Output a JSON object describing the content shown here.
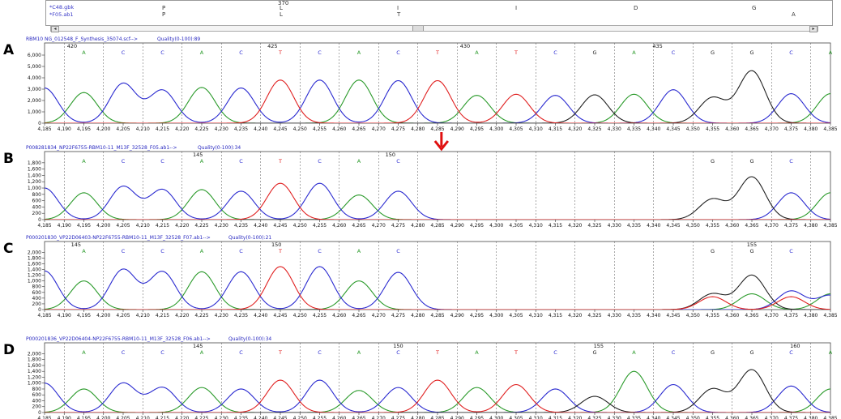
{
  "top_panel": {
    "files": [
      "*C48.gbk",
      "*F05.ab1"
    ],
    "position": "370",
    "aa_rows": [
      [
        {
          "x": 200,
          "t": "P"
        },
        {
          "x": 345,
          "t": "L"
        },
        {
          "x": 490,
          "t": "I"
        },
        {
          "x": 636,
          "t": "I"
        },
        {
          "x": 782,
          "t": "D"
        },
        {
          "x": 928,
          "t": "G"
        }
      ],
      [
        {
          "x": 200,
          "t": "P"
        },
        {
          "x": 345,
          "t": "L"
        },
        {
          "x": 490,
          "t": "T"
        },
        {
          "x": 977,
          "t": "A"
        }
      ]
    ],
    "scroll_left": "◂",
    "scroll_right": "▸"
  },
  "chart_data": [
    {
      "type": "line",
      "panel_label": "A",
      "title": "RBM10 NG_012548_F_Synthesis_35074.scf-->",
      "quality": "Quality(0-100):89",
      "xlim": [
        4185,
        4385
      ],
      "ylim": [
        0,
        6500
      ],
      "yticks": [
        0,
        1000,
        2000,
        3000,
        4000,
        5000,
        6000
      ],
      "position_labels": [
        {
          "x": 4192,
          "t": "420"
        },
        {
          "x": 4243,
          "t": "425"
        },
        {
          "x": 4292,
          "t": "430"
        },
        {
          "x": 4341,
          "t": "435"
        }
      ],
      "bases": [
        {
          "x": 4195,
          "b": "A"
        },
        {
          "x": 4205,
          "b": "C"
        },
        {
          "x": 4215,
          "b": "C"
        },
        {
          "x": 4225,
          "b": "A"
        },
        {
          "x": 4235,
          "b": "C"
        },
        {
          "x": 4245,
          "b": "T"
        },
        {
          "x": 4255,
          "b": "C"
        },
        {
          "x": 4265,
          "b": "A"
        },
        {
          "x": 4275,
          "b": "C"
        },
        {
          "x": 4285,
          "b": "T"
        },
        {
          "x": 4295,
          "b": "A"
        },
        {
          "x": 4305,
          "b": "T"
        },
        {
          "x": 4315,
          "b": "C"
        },
        {
          "x": 4325,
          "b": "G"
        },
        {
          "x": 4335,
          "b": "A"
        },
        {
          "x": 4345,
          "b": "C"
        },
        {
          "x": 4355,
          "b": "G"
        },
        {
          "x": 4365,
          "b": "G"
        },
        {
          "x": 4375,
          "b": "C"
        },
        {
          "x": 4385,
          "b": "A"
        }
      ],
      "peaks": [
        {
          "x": 4185,
          "b": "C",
          "h": 3100
        },
        {
          "x": 4195,
          "b": "A",
          "h": 2700
        },
        {
          "x": 4205,
          "b": "C",
          "h": 3500
        },
        {
          "x": 4215,
          "b": "C",
          "h": 2900
        },
        {
          "x": 4225,
          "b": "A",
          "h": 3150
        },
        {
          "x": 4235,
          "b": "C",
          "h": 3100
        },
        {
          "x": 4245,
          "b": "T",
          "h": 3800
        },
        {
          "x": 4255,
          "b": "C",
          "h": 3800
        },
        {
          "x": 4265,
          "b": "A",
          "h": 3800
        },
        {
          "x": 4275,
          "b": "C",
          "h": 3750
        },
        {
          "x": 4285,
          "b": "T",
          "h": 3750
        },
        {
          "x": 4295,
          "b": "A",
          "h": 2450
        },
        {
          "x": 4305,
          "b": "T",
          "h": 2550
        },
        {
          "x": 4315,
          "b": "C",
          "h": 2450
        },
        {
          "x": 4325,
          "b": "G",
          "h": 2500
        },
        {
          "x": 4335,
          "b": "A",
          "h": 2550
        },
        {
          "x": 4345,
          "b": "C",
          "h": 2950
        },
        {
          "x": 4355,
          "b": "G",
          "h": 2250
        },
        {
          "x": 4365,
          "b": "G",
          "h": 4600
        },
        {
          "x": 4375,
          "b": "C",
          "h": 2600
        },
        {
          "x": 4385,
          "b": "A",
          "h": 2600
        }
      ]
    },
    {
      "type": "line",
      "panel_label": "B",
      "title": "P008281834_NP22F6755-RBM10-11_M13F_32528_F05.ab1-->",
      "quality": "Quality(0-100):34",
      "xlim": [
        4185,
        4385
      ],
      "ylim": [
        0,
        1950
      ],
      "yticks": [
        0,
        200,
        400,
        600,
        800,
        1000,
        1200,
        1400,
        1600,
        1800
      ],
      "position_labels": [
        {
          "x": 4224,
          "t": "145"
        },
        {
          "x": 4273,
          "t": "150"
        }
      ],
      "bases": [
        {
          "x": 4195,
          "b": "A"
        },
        {
          "x": 4205,
          "b": "C"
        },
        {
          "x": 4215,
          "b": "C"
        },
        {
          "x": 4225,
          "b": "A"
        },
        {
          "x": 4235,
          "b": "C"
        },
        {
          "x": 4245,
          "b": "T"
        },
        {
          "x": 4255,
          "b": "C"
        },
        {
          "x": 4265,
          "b": "A"
        },
        {
          "x": 4275,
          "b": "C"
        },
        {
          "x": 4355,
          "b": "G"
        },
        {
          "x": 4365,
          "b": "G"
        },
        {
          "x": 4375,
          "b": "C"
        }
      ],
      "peaks": [
        {
          "x": 4185,
          "b": "C",
          "h": 1000
        },
        {
          "x": 4195,
          "b": "A",
          "h": 850
        },
        {
          "x": 4205,
          "b": "C",
          "h": 1050
        },
        {
          "x": 4215,
          "b": "C",
          "h": 950
        },
        {
          "x": 4225,
          "b": "A",
          "h": 950
        },
        {
          "x": 4235,
          "b": "C",
          "h": 900
        },
        {
          "x": 4245,
          "b": "T",
          "h": 1150
        },
        {
          "x": 4255,
          "b": "C",
          "h": 1150
        },
        {
          "x": 4265,
          "b": "A",
          "h": 780
        },
        {
          "x": 4275,
          "b": "C",
          "h": 900
        },
        {
          "x": 4355,
          "b": "G",
          "h": 650
        },
        {
          "x": 4365,
          "b": "G",
          "h": 1350
        },
        {
          "x": 4375,
          "b": "C",
          "h": 850
        },
        {
          "x": 4385,
          "b": "A",
          "h": 850
        }
      ],
      "arrow_x": 4286
    },
    {
      "type": "line",
      "panel_label": "C",
      "title": "P000201830_VP22D06403-NP22F6755-RBM10-11_M13F_32528_F07.ab1-->",
      "quality": "Quality(0-100):21",
      "xlim": [
        4185,
        4385
      ],
      "ylim": [
        0,
        2150
      ],
      "yticks": [
        0,
        200,
        400,
        600,
        800,
        1000,
        1200,
        1400,
        1600,
        1800,
        2000
      ],
      "position_labels": [
        {
          "x": 4193,
          "t": "145"
        },
        {
          "x": 4244,
          "t": "150"
        },
        {
          "x": 4365,
          "t": "155"
        }
      ],
      "bases": [
        {
          "x": 4195,
          "b": "A"
        },
        {
          "x": 4205,
          "b": "C"
        },
        {
          "x": 4215,
          "b": "C"
        },
        {
          "x": 4225,
          "b": "A"
        },
        {
          "x": 4235,
          "b": "C"
        },
        {
          "x": 4245,
          "b": "T"
        },
        {
          "x": 4255,
          "b": "C"
        },
        {
          "x": 4265,
          "b": "A"
        },
        {
          "x": 4275,
          "b": "C"
        },
        {
          "x": 4355,
          "b": "G"
        },
        {
          "x": 4365,
          "b": "G"
        },
        {
          "x": 4375,
          "b": "C"
        }
      ],
      "peaks": [
        {
          "x": 4185,
          "b": "C",
          "h": 1350
        },
        {
          "x": 4195,
          "b": "A",
          "h": 1000
        },
        {
          "x": 4205,
          "b": "C",
          "h": 1400
        },
        {
          "x": 4215,
          "b": "C",
          "h": 1320
        },
        {
          "x": 4225,
          "b": "A",
          "h": 1320
        },
        {
          "x": 4235,
          "b": "C",
          "h": 1320
        },
        {
          "x": 4245,
          "b": "T",
          "h": 1500
        },
        {
          "x": 4255,
          "b": "C",
          "h": 1500
        },
        {
          "x": 4265,
          "b": "A",
          "h": 1000
        },
        {
          "x": 4275,
          "b": "C",
          "h": 1300
        },
        {
          "x": 4355,
          "b": "G",
          "h": 550
        },
        {
          "x": 4355,
          "b": "T",
          "h": 450
        },
        {
          "x": 4365,
          "b": "G",
          "h": 1200
        },
        {
          "x": 4365,
          "b": "A",
          "h": 550
        },
        {
          "x": 4375,
          "b": "T",
          "h": 450
        },
        {
          "x": 4375,
          "b": "C",
          "h": 650
        },
        {
          "x": 4385,
          "b": "A",
          "h": 550
        },
        {
          "x": 4385,
          "b": "C",
          "h": 500
        }
      ]
    },
    {
      "type": "line",
      "panel_label": "D",
      "title": "P000201836_VP22D06404-NP22F6755-RBM10-11_M13F_32528_F06.ab1-->",
      "quality": "Quality(0-100):34",
      "xlim": [
        4185,
        4385
      ],
      "ylim": [
        0,
        2150
      ],
      "yticks": [
        0,
        200,
        400,
        600,
        800,
        1000,
        1200,
        1400,
        1600,
        1800,
        2000
      ],
      "position_labels": [
        {
          "x": 4224,
          "t": "145"
        },
        {
          "x": 4275,
          "t": "150"
        },
        {
          "x": 4326,
          "t": "155"
        },
        {
          "x": 4376,
          "t": "160"
        }
      ],
      "bases": [
        {
          "x": 4195,
          "b": "A"
        },
        {
          "x": 4205,
          "b": "C"
        },
        {
          "x": 4215,
          "b": "C"
        },
        {
          "x": 4225,
          "b": "A"
        },
        {
          "x": 4235,
          "b": "C"
        },
        {
          "x": 4245,
          "b": "T"
        },
        {
          "x": 4255,
          "b": "C"
        },
        {
          "x": 4265,
          "b": "A"
        },
        {
          "x": 4275,
          "b": "C"
        },
        {
          "x": 4285,
          "b": "T"
        },
        {
          "x": 4295,
          "b": "A"
        },
        {
          "x": 4305,
          "b": "T"
        },
        {
          "x": 4315,
          "b": "C"
        },
        {
          "x": 4325,
          "b": "G"
        },
        {
          "x": 4335,
          "b": "A"
        },
        {
          "x": 4345,
          "b": "C"
        },
        {
          "x": 4355,
          "b": "G"
        },
        {
          "x": 4365,
          "b": "G"
        },
        {
          "x": 4375,
          "b": "C"
        },
        {
          "x": 4385,
          "b": "A"
        }
      ],
      "peaks": [
        {
          "x": 4185,
          "b": "C",
          "h": 1000
        },
        {
          "x": 4195,
          "b": "A",
          "h": 800
        },
        {
          "x": 4205,
          "b": "C",
          "h": 1000
        },
        {
          "x": 4215,
          "b": "C",
          "h": 850
        },
        {
          "x": 4225,
          "b": "A",
          "h": 850
        },
        {
          "x": 4235,
          "b": "C",
          "h": 800
        },
        {
          "x": 4245,
          "b": "T",
          "h": 1100
        },
        {
          "x": 4255,
          "b": "C",
          "h": 1100
        },
        {
          "x": 4265,
          "b": "A",
          "h": 750
        },
        {
          "x": 4275,
          "b": "C",
          "h": 850
        },
        {
          "x": 4285,
          "b": "T",
          "h": 1100
        },
        {
          "x": 4295,
          "b": "A",
          "h": 850
        },
        {
          "x": 4305,
          "b": "T",
          "h": 950
        },
        {
          "x": 4315,
          "b": "C",
          "h": 800
        },
        {
          "x": 4325,
          "b": "G",
          "h": 550
        },
        {
          "x": 4335,
          "b": "A",
          "h": 1400
        },
        {
          "x": 4345,
          "b": "C",
          "h": 950
        },
        {
          "x": 4355,
          "b": "G",
          "h": 800
        },
        {
          "x": 4365,
          "b": "G",
          "h": 1450
        },
        {
          "x": 4375,
          "b": "C",
          "h": 900
        },
        {
          "x": 4385,
          "b": "A",
          "h": 800
        }
      ]
    }
  ],
  "xticks": [
    4185,
    4190,
    4195,
    4200,
    4205,
    4210,
    4215,
    4220,
    4225,
    4230,
    4235,
    4240,
    4245,
    4250,
    4255,
    4260,
    4265,
    4270,
    4275,
    4280,
    4285,
    4290,
    4295,
    4300,
    4305,
    4310,
    4315,
    4320,
    4325,
    4330,
    4335,
    4340,
    4345,
    4350,
    4355,
    4360,
    4365,
    4370,
    4375,
    4380,
    4385
  ],
  "base_colors": {
    "A": "#2a9a2a",
    "C": "#2a2ad0",
    "G": "#202020",
    "T": "#e02020"
  },
  "arrow_color": "#e01010",
  "title_color": "#2828c0"
}
